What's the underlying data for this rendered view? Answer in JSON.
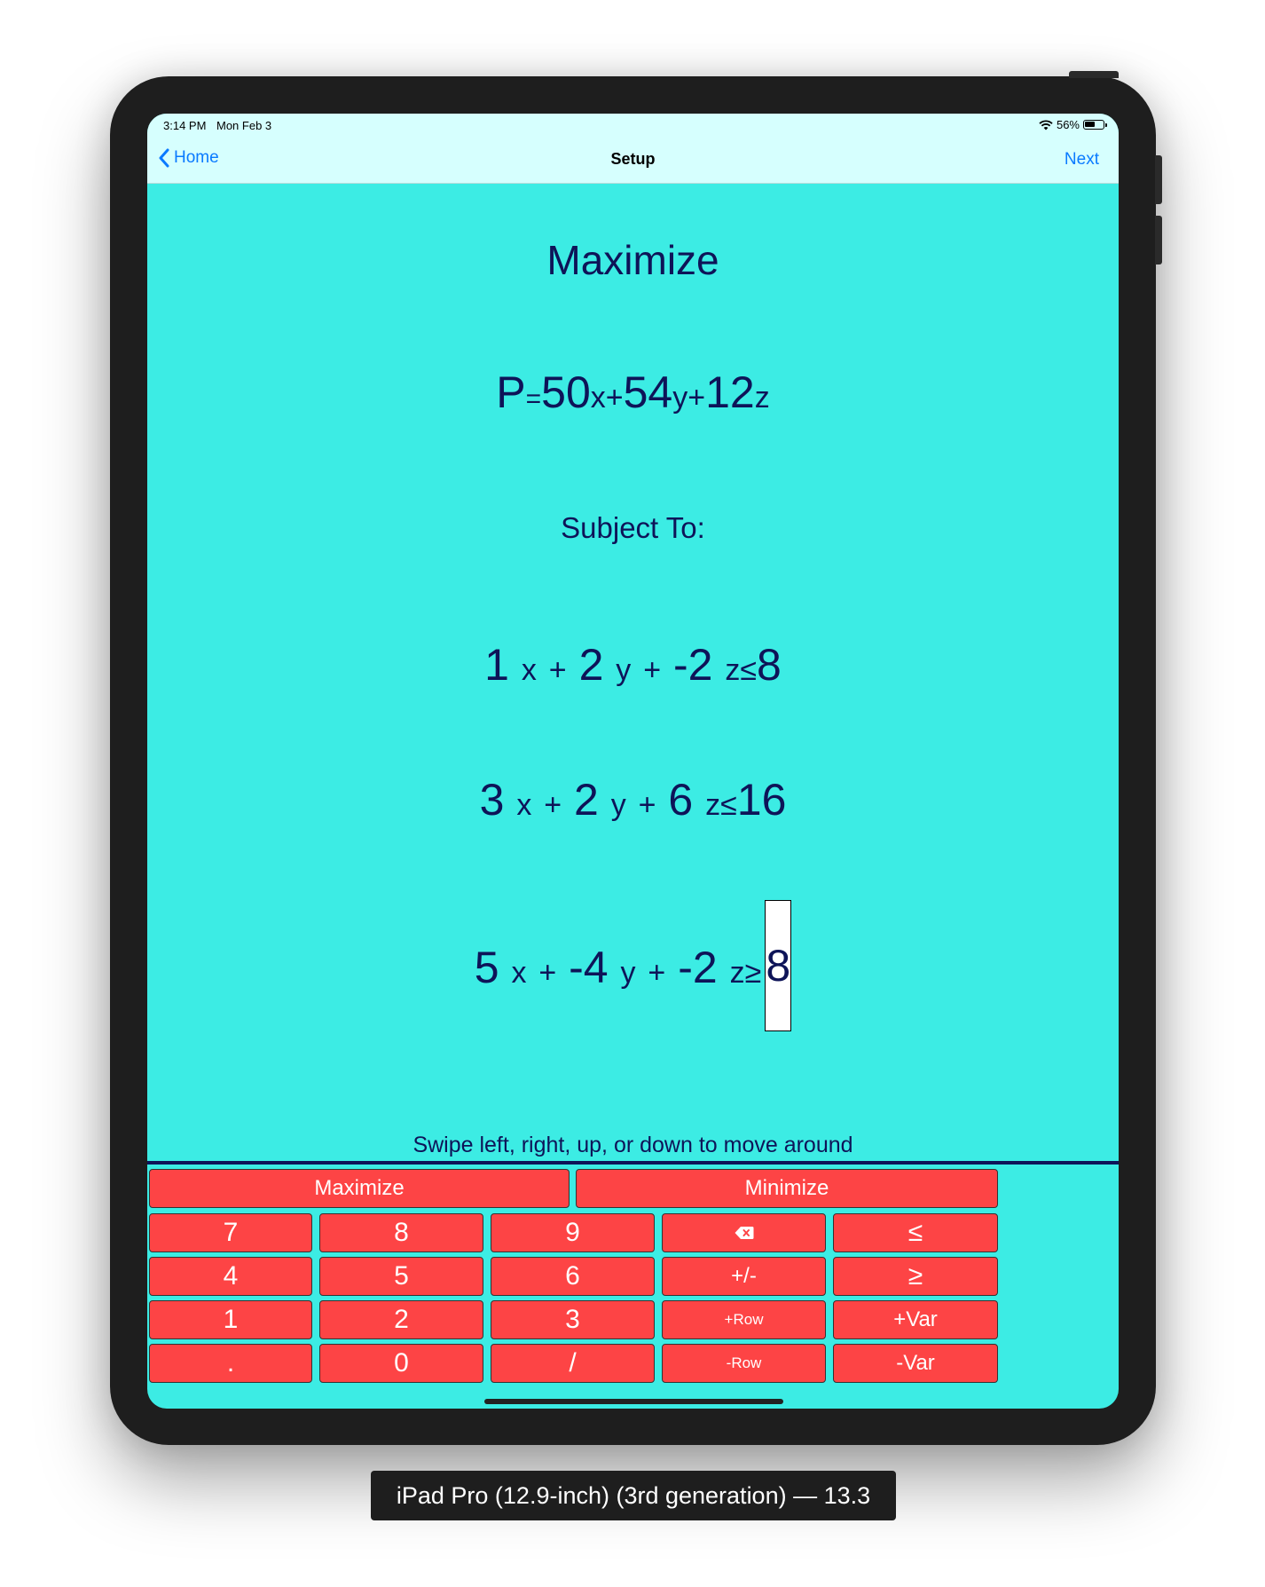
{
  "status": {
    "time": "3:14 PM",
    "date": "Mon Feb 3",
    "battery": "56%"
  },
  "nav": {
    "back": "Home",
    "title": "Setup",
    "next": "Next"
  },
  "goal": "Maximize",
  "objective": {
    "lhs": "P",
    "eq": "=",
    "t1c": "50",
    "t1v": "x",
    "op1": "+",
    "t2c": "54",
    "t2v": "y",
    "op2": "+",
    "t3c": "12",
    "t3v": "z"
  },
  "subject_label": "Subject To:",
  "constraints": [
    {
      "a": "1",
      "x": "x",
      "p1": "+",
      "b": "2",
      "y": "y",
      "p2": "+",
      "c": "-2",
      "z": "z",
      "rel": "≤",
      "rhs": "8"
    },
    {
      "a": "3",
      "x": "x",
      "p1": "+",
      "b": "2",
      "y": "y",
      "p2": "+",
      "c": "6",
      "z": "z",
      "rel": "≤",
      "rhs": "16"
    },
    {
      "a": "5",
      "x": "x",
      "p1": "+",
      "b": "-4",
      "y": "y",
      "p2": "+",
      "c": "-2",
      "z": "z",
      "rel": "≥",
      "rhs": "8"
    }
  ],
  "hint": "Swipe left, right, up, or down to move around",
  "keypad": {
    "maximize": "Maximize",
    "minimize": "Minimize",
    "k7": "7",
    "k8": "8",
    "k9": "9",
    "kle": "≤",
    "k4": "4",
    "k5": "5",
    "k6": "6",
    "kpm": "+/-",
    "kge": "≥",
    "k1": "1",
    "k2": "2",
    "k3": "3",
    "kaddrow": "+Row",
    "kaddvar": "+Var",
    "kdot": ".",
    "k0": "0",
    "kslash": "/",
    "kdelrow": "-Row",
    "kdelvar": "-Var"
  },
  "caption": "iPad Pro (12.9-inch) (3rd generation) — 13.3",
  "colors": {
    "background": "#3cece4",
    "key": "#fd4445",
    "text": "#0e1458",
    "navbar": "#d6fffe",
    "link": "#0a7aff"
  }
}
